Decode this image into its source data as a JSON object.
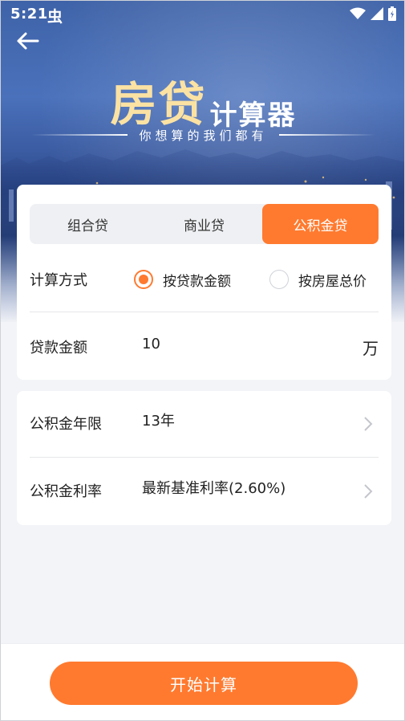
{
  "status_bar": {
    "time": "5:21",
    "notification_glyph": "虫"
  },
  "header": {
    "title_big": "房贷",
    "title_small": "计算器",
    "tagline": "你想算的我们都有"
  },
  "loan_tabs": [
    {
      "label": "组合贷",
      "active": false
    },
    {
      "label": "商业贷",
      "active": false
    },
    {
      "label": "公积金贷",
      "active": true
    }
  ],
  "calc_method": {
    "label": "计算方式",
    "options": [
      {
        "label": "按贷款金额",
        "checked": true
      },
      {
        "label": "按房屋总价",
        "checked": false
      }
    ]
  },
  "loan_amount": {
    "label": "贷款金额",
    "value": "10",
    "unit": "万"
  },
  "fund_years": {
    "label": "公积金年限",
    "value": "13年"
  },
  "fund_rate": {
    "label": "公积金利率",
    "value": "最新基准利率(2.60%)"
  },
  "action": {
    "start_label": "开始计算"
  },
  "colors": {
    "accent": "#ff7a2f",
    "title_gold": "#fbe2a3",
    "hero_blue": "#3f63a8"
  },
  "icons": [
    "back-arrow-icon",
    "wifi-icon",
    "signal-icon",
    "battery-icon",
    "chevron-right-icon"
  ]
}
